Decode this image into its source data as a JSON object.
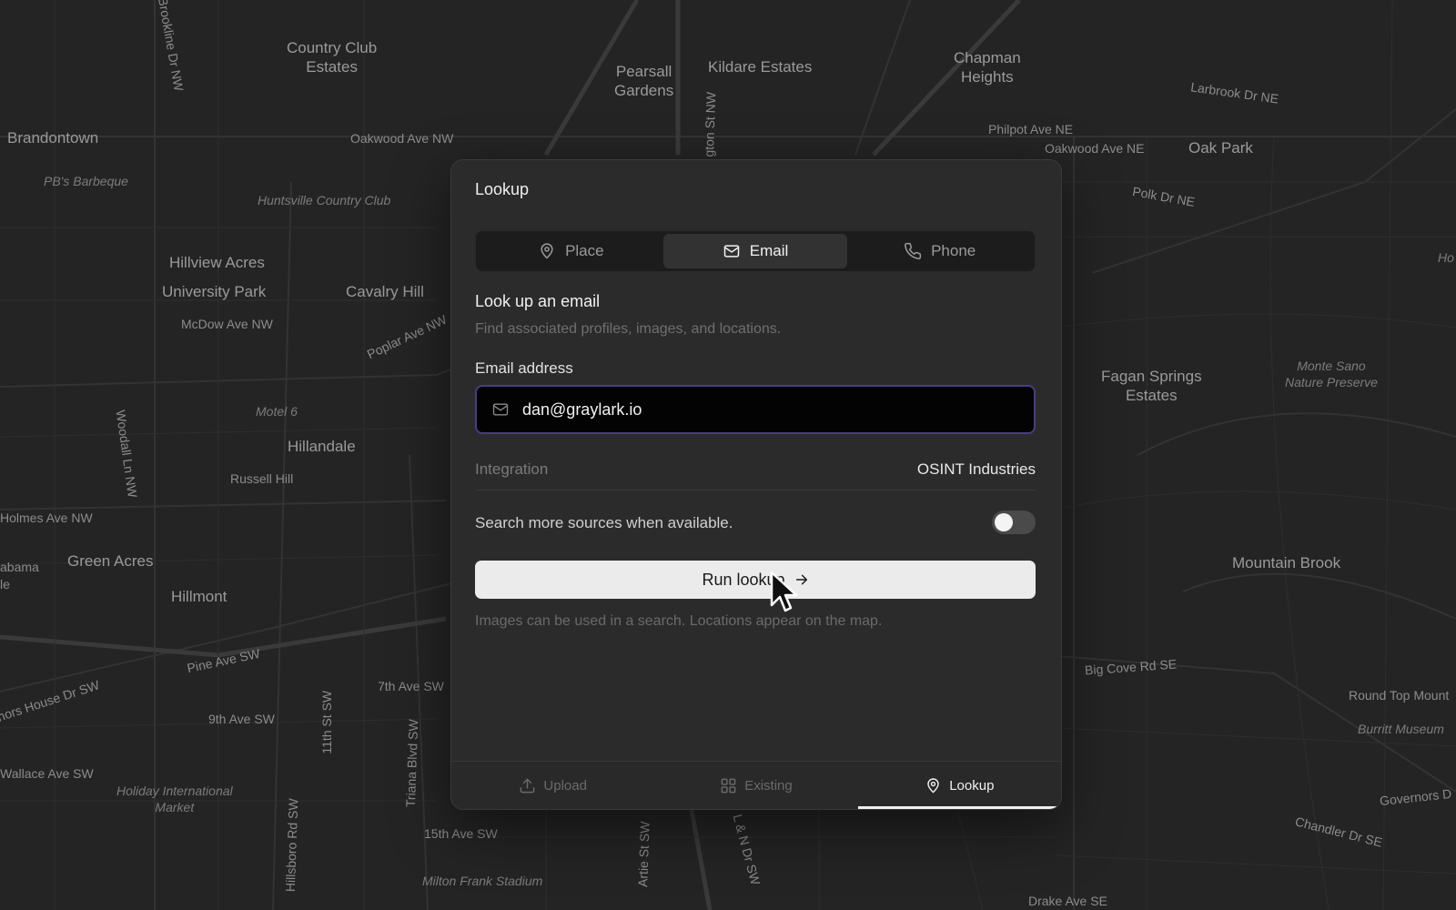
{
  "map": {
    "labels": {
      "country_club_estates": "Country Club\nEstates",
      "pearsall_gardens": "Pearsall\nGardens",
      "kildare_estates": "Kildare Estates",
      "chapman_heights": "Chapman\nHeights",
      "larbrook_dr": "Larbrook Dr NE",
      "philpot_ave": "Philpot Ave NE",
      "oakwood_ave_ne": "Oakwood Ave NE",
      "oak_park": "Oak Park",
      "polk_dr": "Polk Dr NE",
      "brandontown": "Brandontown",
      "oakwood_ave_nw": "Oakwood Ave NW",
      "pbs_barbeque": "PB's Barbeque",
      "huntsville_country_club": "Huntsville Country Club",
      "hillview_acres": "Hillview Acres",
      "university_park": "University Park",
      "cavalry_hill": "Cavalry Hill",
      "mcdow_ave": "McDow Ave NW",
      "poplar_ave": "Poplar Ave NW",
      "motel_6": "Motel 6",
      "hillandale": "Hillandale",
      "russell_hill": "Russell Hill",
      "holmes_ave": "Holmes Ave NW",
      "green_acres": "Green Acres",
      "hillmont": "Hillmont",
      "pine_ave": "Pine Ave SW",
      "seventh_ave": "7th Ave SW",
      "ninth_ave": "9th Ave SW",
      "wallace_ave": "Wallace Ave SW",
      "holiday_intl": "Holiday International\nMarket",
      "fifteenth_ave": "15th Ave SW",
      "milton_frank": "Milton Frank Stadium",
      "fagan_springs": "Fagan Springs\nEstates",
      "monte_sano": "Monte Sano\nNature Preserve",
      "mountain_brook": "Mountain Brook",
      "big_cove_rd": "Big Cove Rd SE",
      "round_top": "Round Top Mount",
      "burritt_museum": "Burritt Museum",
      "governors_dr": "Governors D",
      "chandler_dr": "Chandler Dr SE",
      "drake_ave": "Drake Ave SE",
      "woodall_ln": "Woodall Ln NW",
      "eleventh_st": "11th St SW",
      "triana_blvd": "Triana Blvd SW",
      "hillsboro_rd": "Hillsboro Rd SW",
      "artie_st": "Artie St SW",
      "l_and_n_dr": "L & N Dr SW",
      "brookline_dr": "Brookline Dr NW",
      "washington_st": "gton St NW",
      "manor_house": "nors House Dr SW",
      "alabama": "abama",
      "alabama_2": "le",
      "ho": "Ho"
    }
  },
  "panel": {
    "title": "Lookup",
    "segments": [
      {
        "label": "Place",
        "icon": "map-pin-icon"
      },
      {
        "label": "Email",
        "icon": "mail-icon"
      },
      {
        "label": "Phone",
        "icon": "phone-icon"
      }
    ],
    "active_segment": "Email",
    "section_title": "Look up an email",
    "section_subtitle": "Find associated profiles, images, and locations.",
    "email_label": "Email address",
    "email_value": "dan@graylark.io",
    "integration_key": "Integration",
    "integration_value": "OSINT Industries",
    "toggle_label": "Search more sources when available.",
    "toggle_on": false,
    "run_button_label": "Run lookup",
    "hint": "Images can be used in a search. Locations appear on the map.",
    "bottom_tabs": [
      {
        "label": "Upload",
        "icon": "upload-icon"
      },
      {
        "label": "Existing",
        "icon": "grid-icon"
      },
      {
        "label": "Lookup",
        "icon": "map-pin-icon"
      }
    ],
    "active_bottom_tab": "Lookup"
  },
  "colors": {
    "background": "#242424",
    "panel": "#2c2c2c",
    "input_focus_border": "#4a3c82",
    "button_bg": "#ebebeb"
  }
}
